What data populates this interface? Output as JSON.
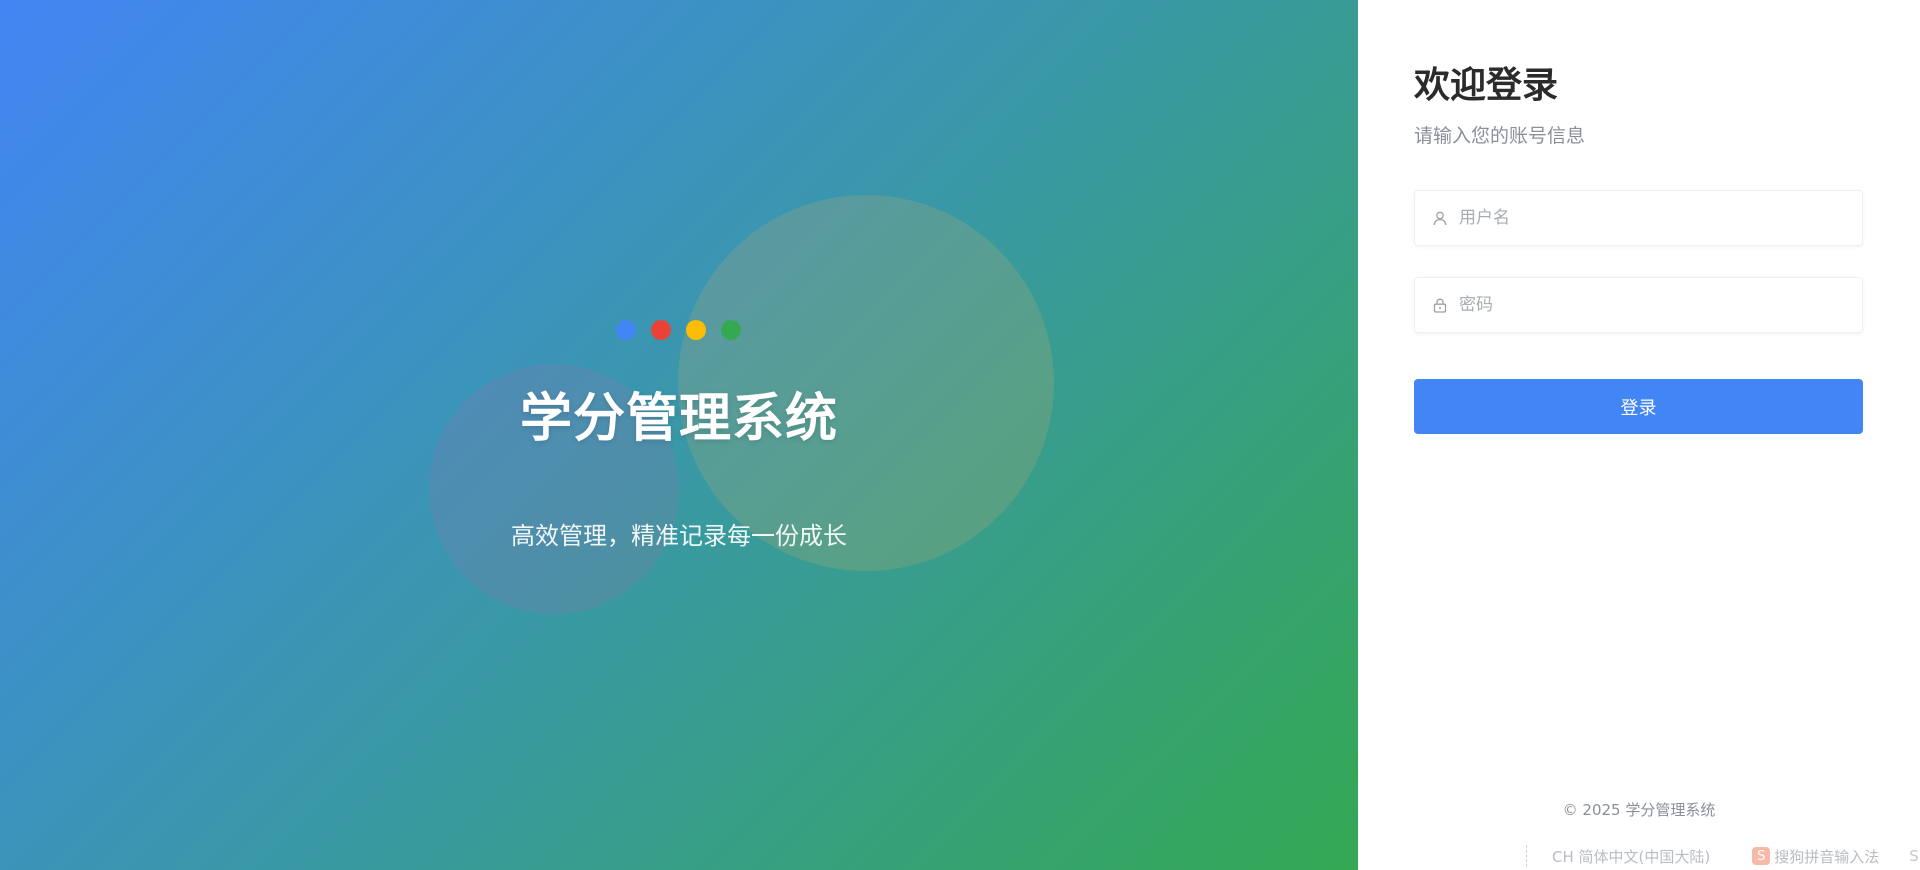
{
  "hero": {
    "title": "学分管理系统",
    "subtitle": "高效管理，精准记录每一份成长",
    "dots": [
      "#4285f4",
      "#ea4335",
      "#fbbc05",
      "#34a853"
    ]
  },
  "login": {
    "heading": "欢迎登录",
    "hint": "请输入您的账号信息",
    "username_placeholder": "用户名",
    "password_placeholder": "密码",
    "submit_label": "登录",
    "accent_color": "#4285f4"
  },
  "footer": {
    "copyright": "© 2025 学分管理系统"
  },
  "ime": {
    "language": "CH 简体中文(中国大陆)",
    "logo_glyph": "S",
    "name": "搜狗拼音输入法",
    "extra_glyph": "S"
  }
}
